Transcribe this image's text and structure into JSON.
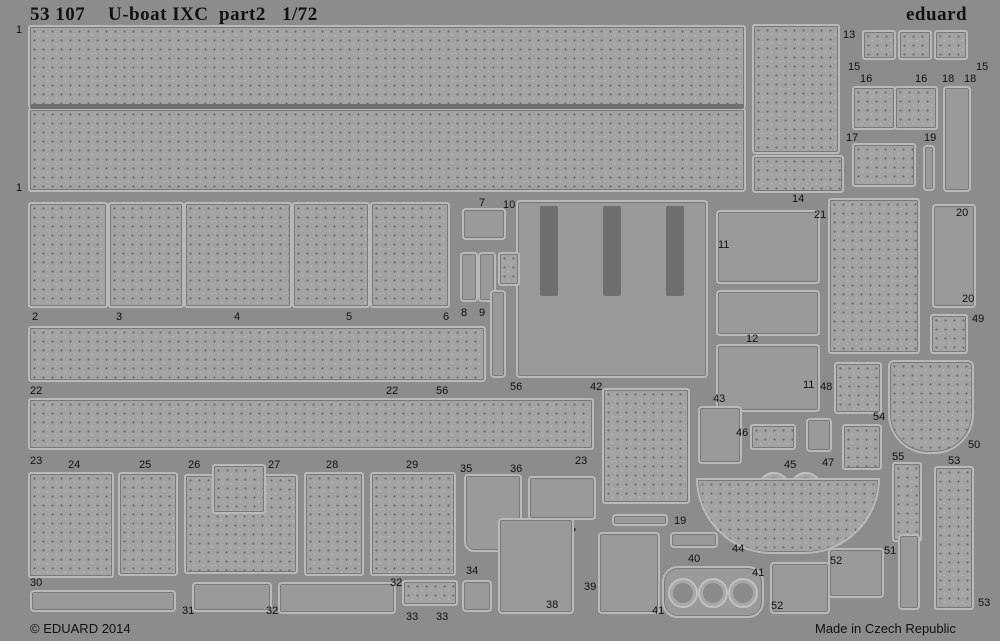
{
  "header": {
    "catalog": "53 107",
    "title": "U-boat IXC",
    "part": "part2",
    "scale": "1/72",
    "brand": "eduard"
  },
  "footer": {
    "copyright": "© EDUARD 2014",
    "origin": "Made in Czech Republic"
  },
  "part_numbers": {
    "p1a": "1",
    "p1b": "1",
    "p2": "2",
    "p3": "3",
    "p4": "4",
    "p5": "5",
    "p6": "6",
    "p7": "7",
    "p8": "8",
    "p9": "9",
    "p10": "10",
    "p11a": "11",
    "p11b": "11",
    "p12": "12",
    "p13": "13",
    "p14": "14",
    "p15a": "15",
    "p15b": "15",
    "p16a": "16",
    "p16b": "16",
    "p17": "17",
    "p18a": "18",
    "p18b": "18",
    "p19a": "19",
    "p19b": "19",
    "p20a": "20",
    "p20b": "20",
    "p21": "21",
    "p22a": "22",
    "p22b": "22",
    "p23a": "23",
    "p23b": "23",
    "p24": "24",
    "p25": "25",
    "p26": "26",
    "p27": "27",
    "p28": "28",
    "p29": "29",
    "p30": "30",
    "p31": "31",
    "p32a": "32",
    "p32b": "32",
    "p33a": "33",
    "p33b": "33",
    "p34": "34",
    "p35": "35",
    "p36": "36",
    "p37": "37",
    "p38": "38",
    "p39": "39",
    "p40": "40",
    "p41a": "41",
    "p41b": "41",
    "p42": "42",
    "p43": "43",
    "p44": "44",
    "p45": "45",
    "p46": "46",
    "p47": "47",
    "p48": "48",
    "p49": "49",
    "p50": "50",
    "p51": "51",
    "p52a": "52",
    "p52b": "52",
    "p53a": "53",
    "p53b": "53",
    "p54": "54",
    "p55": "55",
    "p56": "56"
  }
}
